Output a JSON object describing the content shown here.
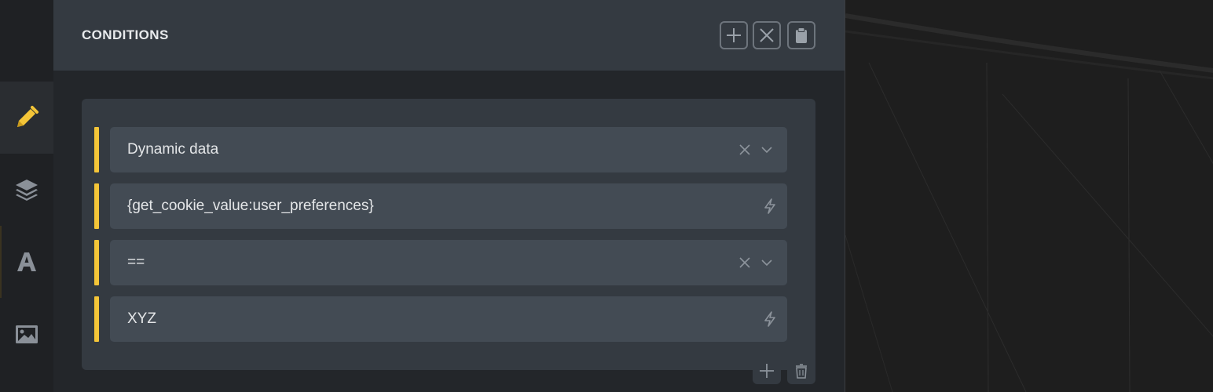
{
  "rail": {
    "items": [
      {
        "icon": "pencil-icon",
        "active": true
      },
      {
        "icon": "layers-icon",
        "active": false
      },
      {
        "icon": "typography-icon",
        "active": false
      },
      {
        "icon": "image-icon",
        "active": false
      }
    ]
  },
  "panel": {
    "title": "CONDITIONS",
    "header_actions": [
      "add-icon",
      "close-icon",
      "clipboard-icon"
    ]
  },
  "condition": {
    "fields": [
      {
        "value": "Dynamic data",
        "type": "select",
        "icons": [
          "clear-icon",
          "chevron-down-icon"
        ]
      },
      {
        "value": "{get_cookie_value:user_preferences}",
        "type": "input",
        "icons": [
          "dynamic-data-bolt-icon"
        ]
      },
      {
        "value": "==",
        "type": "select",
        "icons": [
          "clear-icon",
          "chevron-down-icon"
        ]
      },
      {
        "value": "XYZ",
        "type": "input",
        "icons": [
          "dynamic-data-bolt-icon"
        ]
      }
    ],
    "footer_actions": [
      "add-icon",
      "trash-icon"
    ]
  },
  "colors": {
    "accent": "#f4c538",
    "panel_bg": "#23262a",
    "header_bg": "#343a41",
    "field_bg": "#434b54",
    "text": "#e4e6e8"
  }
}
